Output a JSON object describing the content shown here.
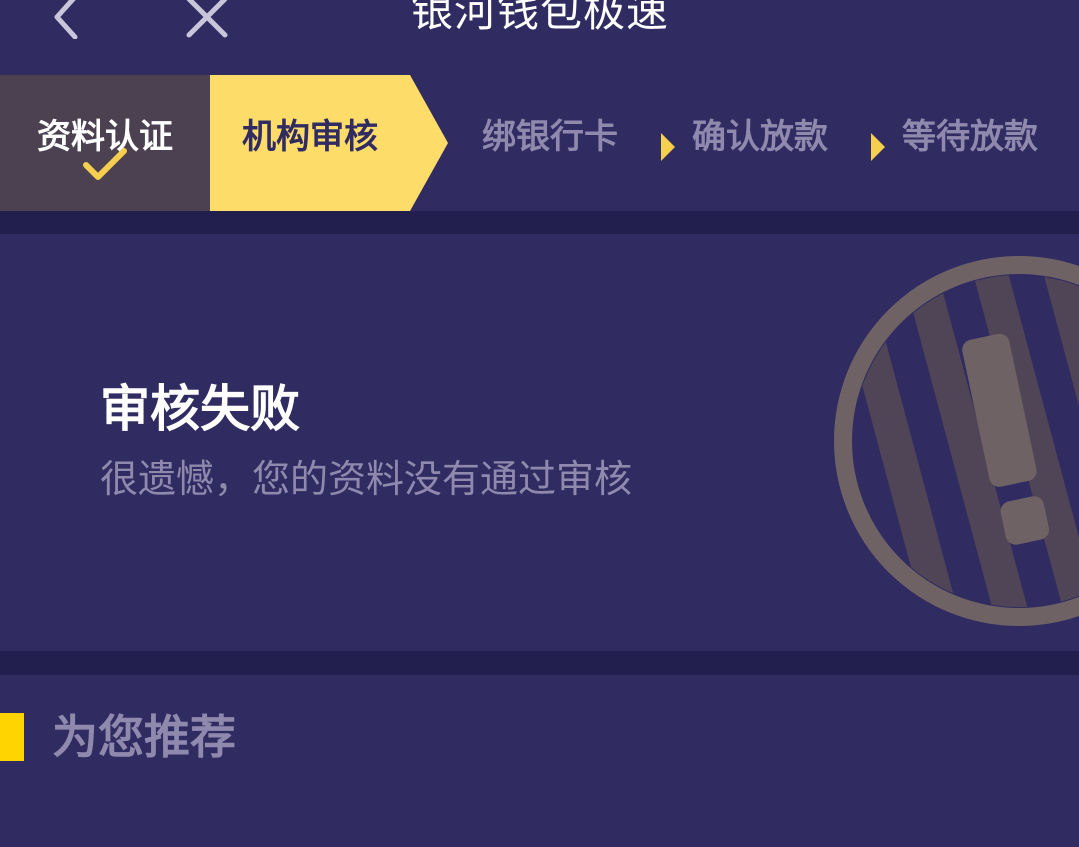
{
  "header": {
    "title": "银河钱包极速",
    "back_icon": "chevron-left-icon",
    "close_icon": "close-icon"
  },
  "steps": [
    {
      "label": "资料认证",
      "state": "done"
    },
    {
      "label": "机构审核",
      "state": "active"
    },
    {
      "label": "绑银行卡",
      "state": "pending"
    },
    {
      "label": "确认放款",
      "state": "pending"
    },
    {
      "label": "等待放款",
      "state": "pending"
    }
  ],
  "status": {
    "title": "审核失败",
    "description": "很遗憾，您的资料没有通过审核",
    "badge_icon": "exclamation-stamp-icon"
  },
  "recommend": {
    "title": "为您推荐"
  },
  "colors": {
    "background": "#302c61",
    "divider": "#221f4f",
    "accent": "#ffd400",
    "active_step": "#fddc6a",
    "done_step": "#4c4150",
    "muted_text": "#8f89ae",
    "badge": "#6f6265"
  }
}
